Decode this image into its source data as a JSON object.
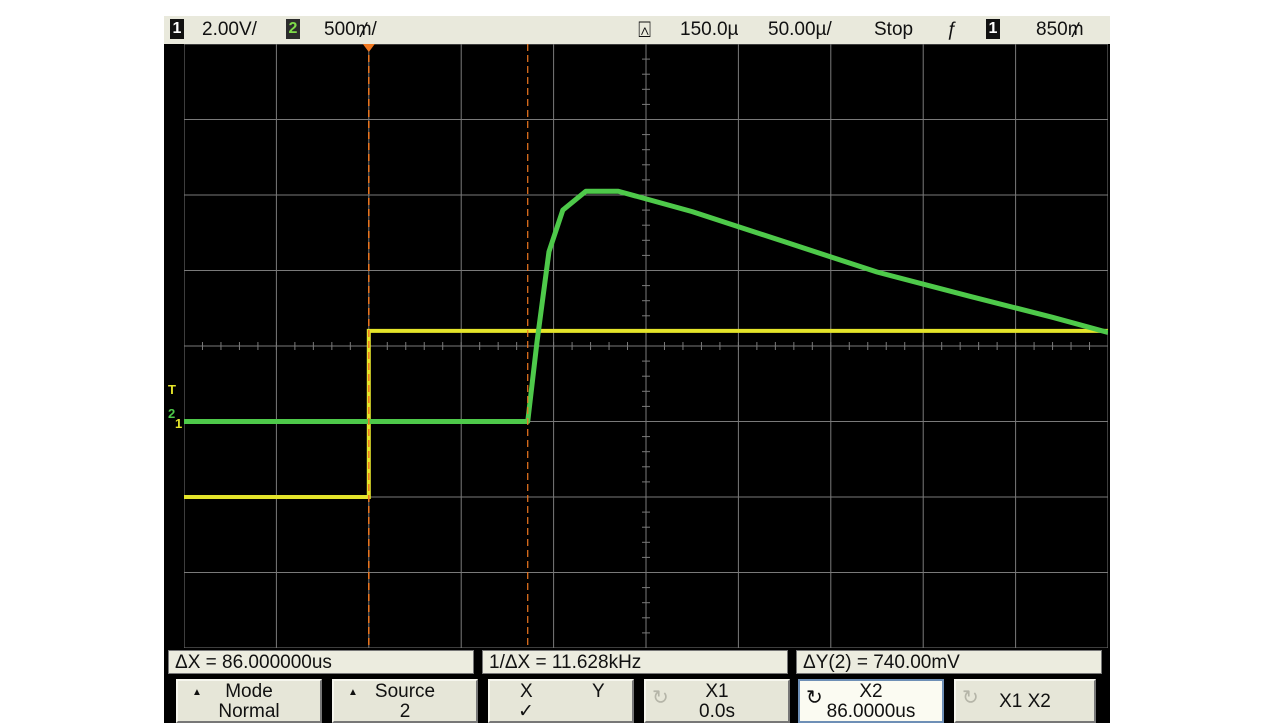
{
  "status_bar": {
    "ch1_number": "1",
    "ch1_scale": "2.00V/",
    "ch2_number": "2",
    "ch2_scale": "500₥/",
    "trigger_delay": "150.0µ",
    "time_scale": "50.00µ/",
    "run_state": "Stop",
    "trigger_slope_symbol": "ƒ",
    "trigger_source_number": "1",
    "trigger_level": "850₥"
  },
  "measurements": {
    "delta_x": "ΔX = 86.000000us",
    "inverse_delta_x": "1/ΔX = 11.628kHz",
    "delta_y": "ΔY(2) = 740.00mV"
  },
  "softkeys": {
    "mode": {
      "label": "Mode",
      "value": "Normal"
    },
    "source": {
      "label": "Source",
      "value": "2"
    },
    "xy": {
      "x_label": "X",
      "y_label": "Y",
      "selected_mark": "✓"
    },
    "x1": {
      "label": "X1",
      "value": "0.0s"
    },
    "x2": {
      "label": "X2",
      "value": "86.0000us"
    },
    "x1x2": {
      "label": "X1 X2"
    }
  },
  "ground_markers": {
    "trigger_marker": "T",
    "ch2_marker": "2",
    "ch1_marker": "1"
  },
  "colors": {
    "channel1": "#e4e42a",
    "channel2": "#4ec94a",
    "cursor": "#f07820",
    "grid": "#7a7a7a"
  },
  "chart_data": {
    "type": "line",
    "title": "",
    "time_per_division_us": 50,
    "x_divisions": 10,
    "y_divisions": 8,
    "series": [
      {
        "channel": "1",
        "volts_per_division": 2.0,
        "x_div": [
          0,
          2.0,
          2.0,
          10.0
        ],
        "y_div": [
          -2.0,
          -2.0,
          0.2,
          0.2
        ]
      },
      {
        "channel": "2",
        "volts_per_division": 0.5,
        "x_div": [
          0,
          3.72,
          3.82,
          3.95,
          4.1,
          4.35,
          4.7,
          5.5,
          6.5,
          7.5,
          8.5,
          9.4,
          10.0
        ],
        "y_div": [
          -1.0,
          -1.0,
          0.05,
          1.25,
          1.8,
          2.05,
          2.05,
          1.78,
          1.38,
          0.98,
          0.66,
          0.38,
          0.18
        ]
      }
    ],
    "cursors": {
      "x1_us": 0.0,
      "x2_us": 86.0
    }
  }
}
